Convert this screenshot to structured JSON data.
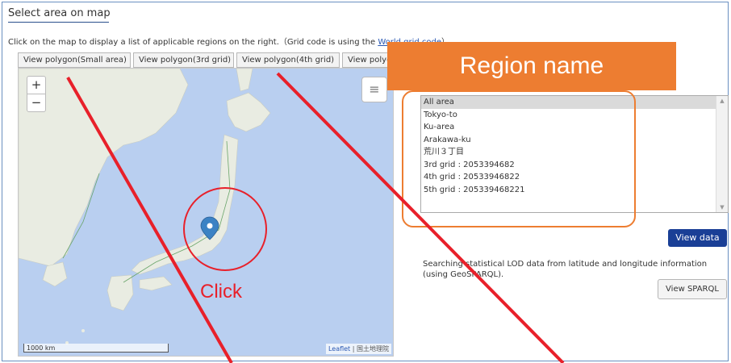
{
  "header": {
    "title": "Select area on map"
  },
  "instructions": {
    "text": "Click on the map to display a list of applicable regions on the right.（Grid code is using the ",
    "link": "World grid code",
    "suffix": "）"
  },
  "map_tabs": [
    {
      "label": "View polygon(Small area)"
    },
    {
      "label": "View polygon(3rd grid)"
    },
    {
      "label": "View polygon(4th grid)"
    },
    {
      "label": "View polygon(5th grid)"
    }
  ],
  "map": {
    "zoom_in": "+",
    "zoom_out": "−",
    "scale_label": "1000 km",
    "attribution_leaflet": "Leaflet",
    "attribution_gsi": "| 国土地理院",
    "marker_color": "#3b82c4"
  },
  "annotations": {
    "region_banner": "Region name",
    "click": "Click",
    "accent_orange": "#ed7d31",
    "accent_red": "#e8202a"
  },
  "regions": [
    {
      "label": "All area",
      "selected": true
    },
    {
      "label": "Tokyo-to"
    },
    {
      "label": "Ku-area"
    },
    {
      "label": "Arakawa-ku"
    },
    {
      "label": "荒川３丁目"
    },
    {
      "label": "3rd grid : 2053394682"
    },
    {
      "label": "4th grid : 2053394682​2"
    },
    {
      "label": "5th grid : 205339468221"
    }
  ],
  "buttons": {
    "view_data": "View data",
    "view_sparql": "View SPARQL"
  },
  "searching_text": "Searching statistical LOD data from latitude and longitude information (using GeoSPARQL).",
  "colors": {
    "primary": "#1a3f96",
    "map_sea": "#b9cff0",
    "land": "#e8e8e0"
  }
}
